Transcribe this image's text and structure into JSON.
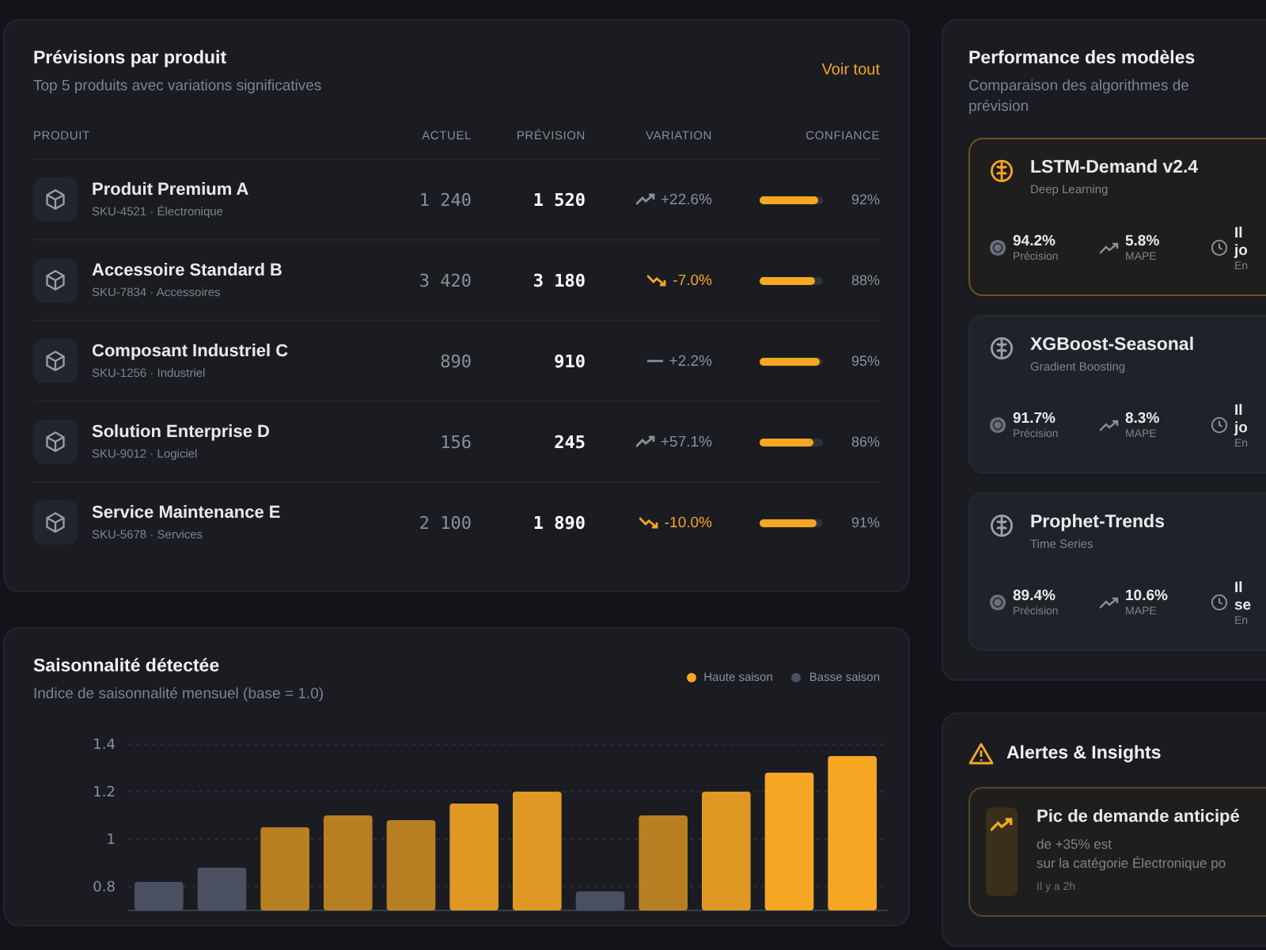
{
  "forecast": {
    "title": "Prévisions par produit",
    "subtitle": "Top 5 produits avec variations significatives",
    "link": "Voir tout",
    "columns": [
      "PRODUIT",
      "ACTUEL",
      "PRÉVISION",
      "VARIATION",
      "CONFIANCE"
    ],
    "rows": [
      {
        "name": "Produit Premium A",
        "meta": "SKU-4521 · Électronique",
        "actual": "1 240",
        "forecast": "1 520",
        "kind": "up",
        "variation": "+22.6%",
        "level": 0.92,
        "confidence": "92%"
      },
      {
        "name": "Accessoire Standard B",
        "meta": "SKU-7834 · Accessoires",
        "actual": "3 420",
        "forecast": "3 180",
        "kind": "down",
        "variation": "-7.0%",
        "level": 0.88,
        "confidence": "88%"
      },
      {
        "name": "Composant Industriel C",
        "meta": "SKU-1256 · Industriel",
        "actual": "890",
        "forecast": "910",
        "kind": "flat",
        "variation": "+2.2%",
        "level": 0.95,
        "confidence": "95%"
      },
      {
        "name": "Solution Enterprise D",
        "meta": "SKU-9012 · Logiciel",
        "actual": "156",
        "forecast": "245",
        "kind": "up",
        "variation": "+57.1%",
        "level": 0.86,
        "confidence": "86%"
      },
      {
        "name": "Service Maintenance E",
        "meta": "SKU-5678 · Services",
        "actual": "2 100",
        "forecast": "1 890",
        "kind": "down",
        "variation": "-10.0%",
        "level": 0.91,
        "confidence": "91%"
      }
    ]
  },
  "seasonality": {
    "title": "Saisonnalité détectée",
    "subtitle": "Indice de saisonnalité mensuel (base = 1.0)",
    "chart_data": {
      "type": "bar",
      "grid": true,
      "yticks": [
        0.8,
        1,
        1.2,
        1.4
      ],
      "ylim": [
        0.7,
        1.4
      ],
      "series": [
        {
          "name": "Haute saison",
          "color": "#f5a623",
          "values": [
            null,
            null,
            1.05,
            1.1,
            1.08,
            1.15,
            1.2,
            null,
            1.1,
            1.2,
            1.28,
            1.35
          ]
        },
        {
          "name": "Basse saison",
          "color": "#4b5060",
          "values": [
            0.82,
            0.88,
            null,
            null,
            null,
            null,
            null,
            0.78,
            null,
            null,
            null,
            null
          ]
        }
      ]
    }
  },
  "models": {
    "title": "Performance des modèles",
    "subtitle": "Comparaison des algorithmes de prévision",
    "items": [
      {
        "name": "LSTM-Demand v2.4",
        "type": "Deep Learning",
        "selected": true,
        "precision": "94.2%",
        "precision_label": "Précision",
        "mape": "5.8%",
        "mape_label": "MAPE",
        "updated": [
          "Il",
          "jo"
        ],
        "updated_label": "En"
      },
      {
        "name": "XGBoost-Seasonal",
        "type": "Gradient Boosting",
        "selected": false,
        "precision": "91.7%",
        "precision_label": "Précision",
        "mape": "8.3%",
        "mape_label": "MAPE",
        "updated": [
          "Il",
          "jo"
        ],
        "updated_label": "En"
      },
      {
        "name": "Prophet-Trends",
        "type": "Time Series",
        "selected": false,
        "precision": "89.4%",
        "precision_label": "Précision",
        "mape": "10.6%",
        "mape_label": "MAPE",
        "updated": [
          "Il",
          "se"
        ],
        "updated_label": "En"
      }
    ]
  },
  "alerts": {
    "title": "Alertes & Insights",
    "items": [
      {
        "title": "Pic de demande anticipé",
        "lines": [
          "de +35% est",
          "sur la catégorie Électronique po"
        ],
        "time": "Il y a 2h"
      }
    ]
  }
}
